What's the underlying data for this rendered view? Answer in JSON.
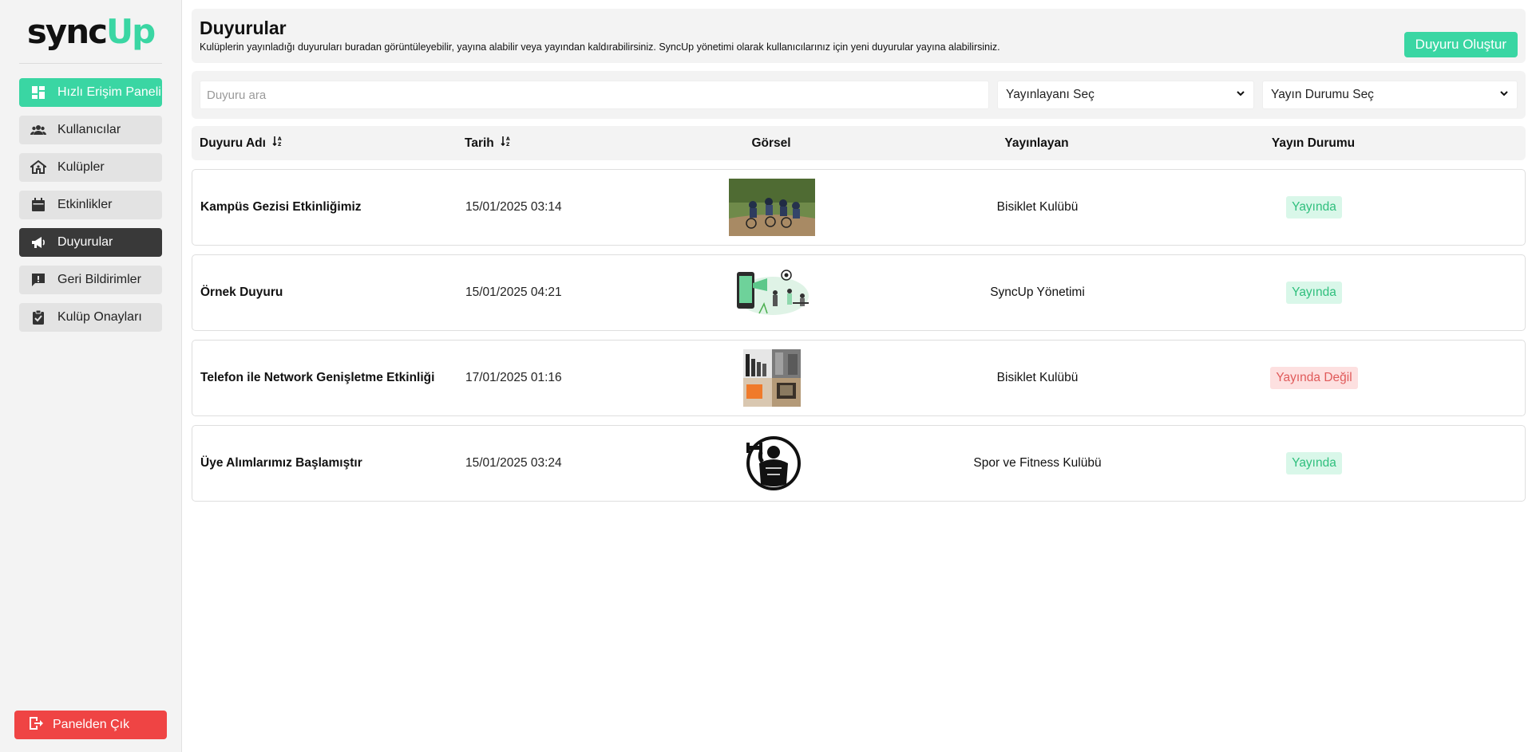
{
  "logo": {
    "part1": "sync",
    "part2": "Up"
  },
  "sidebar": {
    "items": [
      {
        "label": "Hızlı Erişim Paneli",
        "icon": "dashboard-icon"
      },
      {
        "label": "Kullanıcılar",
        "icon": "users-icon"
      },
      {
        "label": "Kulüpler",
        "icon": "clubs-icon"
      },
      {
        "label": "Etkinlikler",
        "icon": "calendar-icon"
      },
      {
        "label": "Duyurular",
        "icon": "megaphone-icon"
      },
      {
        "label": "Geri Bildirimler",
        "icon": "feedback-icon"
      },
      {
        "label": "Kulüp Onayları",
        "icon": "clipboard-check-icon"
      }
    ],
    "logout_label": "Panelden Çık"
  },
  "header": {
    "title": "Duyurular",
    "description": "Kulüplerin yayınladığı duyuruları buradan görüntüleyebilir, yayına alabilir veya yayından kaldırabilirsiniz. SyncUp yönetimi olarak kullanıcılarınız için yeni duyurular yayına alabilirsiniz.",
    "create_button": "Duyuru Oluştur"
  },
  "filters": {
    "search_placeholder": "Duyuru ara",
    "publisher_select": "Yayınlayanı Seç",
    "status_select": "Yayın Durumu Seç"
  },
  "table": {
    "columns": [
      "Duyuru Adı",
      "Tarih",
      "Görsel",
      "Yayınlayan",
      "Yayın Durumu"
    ],
    "rows": [
      {
        "name": "Kampüs Gezisi Etkinliğimiz",
        "date": "15/01/2025 03:14",
        "image": "cyclists-photo",
        "publisher": "Bisiklet Kulübü",
        "status": "Yayında",
        "active": true
      },
      {
        "name": "Örnek Duyuru",
        "date": "15/01/2025 04:21",
        "image": "announcement-illustration",
        "publisher": "SyncUp Yönetimi",
        "status": "Yayında",
        "active": true
      },
      {
        "name": "Telefon ile Network Genişletme Etkinliği",
        "date": "17/01/2025 01:16",
        "image": "phones-collage",
        "publisher": "Bisiklet Kulübü",
        "status": "Yayında Değil",
        "active": false
      },
      {
        "name": "Üye Alımlarımız Başlamıştır",
        "date": "15/01/2025 03:24",
        "image": "fitness-logo",
        "publisher": "Spor ve Fitness Kulübü",
        "status": "Yayında",
        "active": true
      }
    ]
  },
  "colors": {
    "accent": "#3ad6a3",
    "active_nav": "#393939",
    "danger": "#ef4444"
  }
}
